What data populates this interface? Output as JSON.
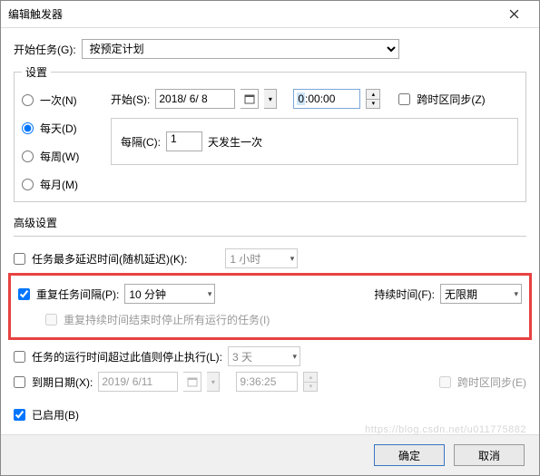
{
  "title": "编辑触发器",
  "begin_task_label": "开始任务(G):",
  "begin_task_value": "按预定计划",
  "settings_legend": "设置",
  "freq": {
    "once": "一次(N)",
    "daily": "每天(D)",
    "weekly": "每周(W)",
    "monthly": "每月(M)"
  },
  "start_label": "开始(S):",
  "start_date": "2018/ 6/ 8",
  "start_time_hl": "0",
  "start_time_rest": ":00:00",
  "sync_tz": "跨时区同步(Z)",
  "interval_label": "每隔(C):",
  "interval_value": "1",
  "interval_suffix": "天发生一次",
  "adv_title": "高级设置",
  "delay_label": "任务最多延迟时间(随机延迟)(K):",
  "delay_value": "1 小时",
  "repeat_label": "重复任务间隔(P):",
  "repeat_value": "10 分钟",
  "duration_label": "持续时间(F):",
  "duration_value": "无限期",
  "stop_all_label": "重复持续时间结束时停止所有运行的任务(I)",
  "stop_after_label": "任务的运行时间超过此值则停止执行(L):",
  "stop_after_value": "3 天",
  "expire_label": "到期日期(X):",
  "expire_date": "2019/ 6/11",
  "expire_time": "9:36:25",
  "sync_tz2": "跨时区同步(E)",
  "enabled_label": "已启用(B)",
  "ok": "确定",
  "cancel": "取消",
  "watermark": "https://blog.csdn.net/u011775882"
}
